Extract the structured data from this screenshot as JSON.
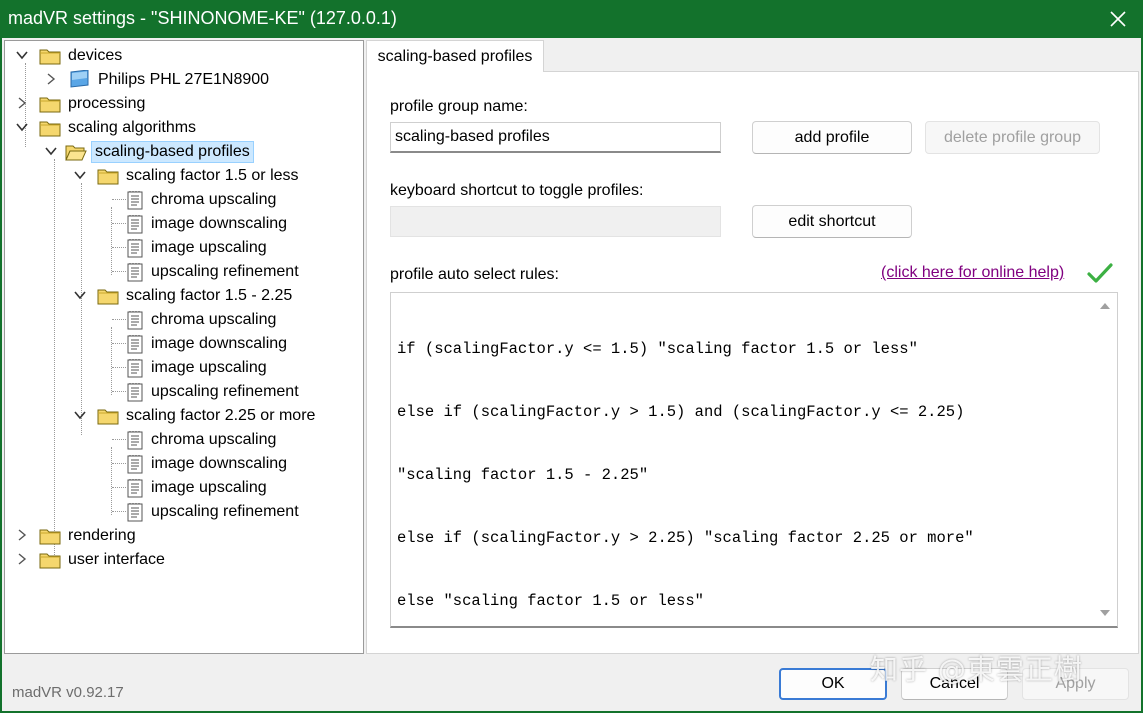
{
  "window": {
    "title": "madVR settings - \"SHINONOME-KE\" (127.0.0.1)"
  },
  "tree": {
    "devices": "devices",
    "monitor": "Philips PHL 27E1N8900",
    "processing": "processing",
    "scaling_algorithms": "scaling algorithms",
    "scaling_profiles": "scaling-based profiles",
    "group1": {
      "label": "scaling factor 1.5 or less",
      "items": [
        "chroma upscaling",
        "image downscaling",
        "image upscaling",
        "upscaling refinement"
      ]
    },
    "group2": {
      "label": "scaling factor 1.5 - 2.25",
      "items": [
        "chroma upscaling",
        "image downscaling",
        "image upscaling",
        "upscaling refinement"
      ]
    },
    "group3": {
      "label": "scaling factor 2.25 or more",
      "items": [
        "chroma upscaling",
        "image downscaling",
        "image upscaling",
        "upscaling refinement"
      ]
    },
    "rendering": "rendering",
    "user_interface": "user interface"
  },
  "version": "madVR v0.92.17",
  "tab": {
    "label": "scaling-based profiles"
  },
  "form": {
    "group_name_label": "profile group name:",
    "group_name_value": "scaling-based profiles",
    "add_profile": "add profile",
    "delete_group": "delete profile group",
    "shortcut_label": "keyboard shortcut to toggle profiles:",
    "shortcut_value": "",
    "edit_shortcut": "edit shortcut",
    "rules_label": "profile auto select rules:",
    "help_link": "(click here for online help)",
    "rules_lines": [
      "if (scalingFactor.y <= 1.5) \"scaling factor 1.5 or less\"",
      "else if (scalingFactor.y > 1.5) and (scalingFactor.y <= 2.25)",
      "\"scaling factor 1.5 - 2.25\"",
      "else if (scalingFactor.y > 2.25) \"scaling factor 2.25 or more\"",
      "else \"scaling factor 1.5 or less\""
    ]
  },
  "buttons": {
    "ok": "OK",
    "cancel": "Cancel",
    "apply": "Apply"
  },
  "watermark": "知乎 @東雲正樹",
  "colors": {
    "titlebar": "#13722c",
    "folder": "#f5d76e",
    "selection": "#cce8ff",
    "link": "#800080",
    "check": "#3cb043"
  }
}
